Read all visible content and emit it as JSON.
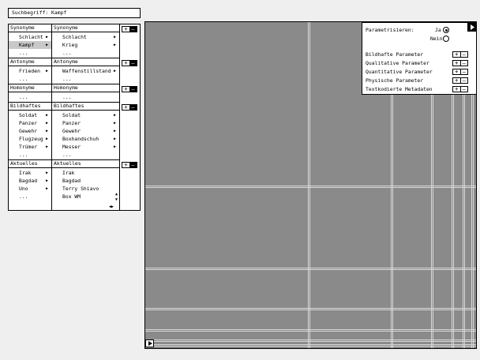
{
  "search": {
    "label": "Suchbegriff:",
    "value": "Kampf"
  },
  "sections": [
    {
      "title_left": "Synonyme",
      "title_right": "Synonyme",
      "left": [
        "Schlacht",
        "Kampf",
        "..."
      ],
      "right": [
        "Schlacht",
        "Krieg",
        "..."
      ],
      "selected_left": 1
    },
    {
      "title_left": "Antonyme",
      "title_right": "Antonyme",
      "left": [
        "Frieden",
        "..."
      ],
      "right": [
        "Waffenstillstand",
        "..."
      ]
    },
    {
      "title_left": "Homonyme",
      "title_right": "Homonyme",
      "left": [
        "..."
      ],
      "right": [
        "..."
      ]
    },
    {
      "title_left": "Bildhaftes",
      "title_right": "Bildhaftes",
      "left": [
        "Soldat",
        "Panzer",
        "Gewehr",
        "Flugzeug",
        "Trümer",
        "..."
      ],
      "right": [
        "Soldat",
        "Panzer",
        "Gewehr",
        "Boxhandschuh",
        "Messer",
        "..."
      ]
    },
    {
      "title_left": "Aktuelles",
      "title_right": "Aktuelles",
      "left": [
        "Irak",
        "Bagdad",
        "Uno",
        "..."
      ],
      "right": [
        "Irak",
        "Bagdad",
        "Terry Shiavo",
        "Box WM"
      ]
    }
  ],
  "plus_minus": {
    "plus": "+",
    "minus": "–"
  },
  "params": {
    "title": "Parametrisieren:",
    "yes": "Ja",
    "no": "Nein",
    "selected": "yes",
    "items": [
      "Bildhafte Parameter",
      "Qualitative Parameter",
      "Quantitative Parameter",
      "Physische Parameter",
      "Textkodierte Metadaten"
    ]
  },
  "icons": {
    "tools": [
      "windows-icon",
      "zoom-icon",
      "pointer-icon"
    ],
    "active_tool": 2
  },
  "colors": {
    "canvas": "#8a8a8a",
    "selection": "#c8c8c8"
  }
}
